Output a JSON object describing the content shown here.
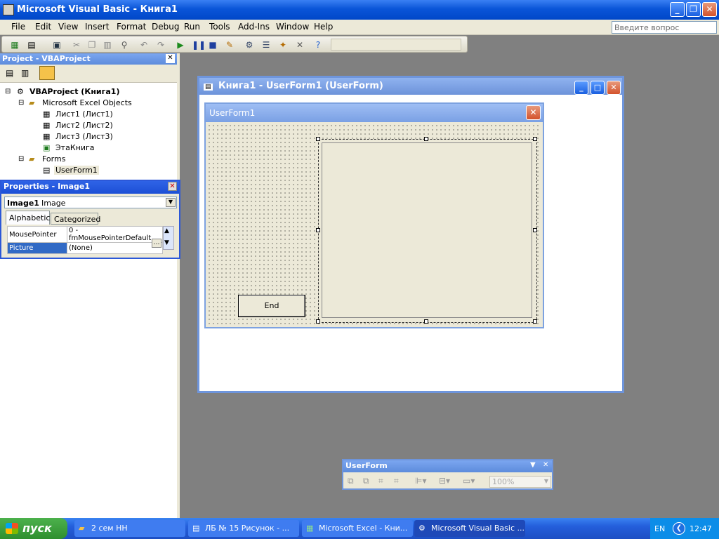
{
  "window": {
    "title": "Microsoft Visual Basic - Книга1"
  },
  "menu": {
    "items": [
      "File",
      "Edit",
      "View",
      "Insert",
      "Format",
      "Debug",
      "Run",
      "Tools",
      "Add-Ins",
      "Window",
      "Help"
    ]
  },
  "ask": {
    "placeholder": "Введите вопрос"
  },
  "project": {
    "title": "Project - VBAProject",
    "root": "VBAProject (Книга1)",
    "excel_objects": "Microsoft Excel Objects",
    "sheets": [
      "Лист1 (Лист1)",
      "Лист2 (Лист2)",
      "Лист3 (Лист3)"
    ],
    "workbook": "ЭтаКнига",
    "forms": "Forms",
    "form": "UserForm1"
  },
  "properties": {
    "title": "Properties - Image1",
    "object": "Image1",
    "object_type": "Image",
    "tabs": [
      "Alphabetic",
      "Categorized"
    ],
    "rows": [
      {
        "name": "MousePointer",
        "value": "0 - fmMousePointerDefault"
      },
      {
        "name": "Picture",
        "value": "(None)"
      }
    ]
  },
  "designer": {
    "title": "Книга1 - UserForm1 (UserForm)",
    "form_caption": "UserForm1",
    "button_label": "End"
  },
  "userform_toolbar": {
    "title": "UserForm",
    "zoom": "100%"
  },
  "taskbar": {
    "start": "пуск",
    "tasks": [
      "2 сем НН",
      "ЛБ № 15 Рисунок - ...",
      "Microsoft Excel - Кни...",
      "Microsoft Visual Basic ..."
    ],
    "lang": "EN",
    "time": "12:47"
  }
}
